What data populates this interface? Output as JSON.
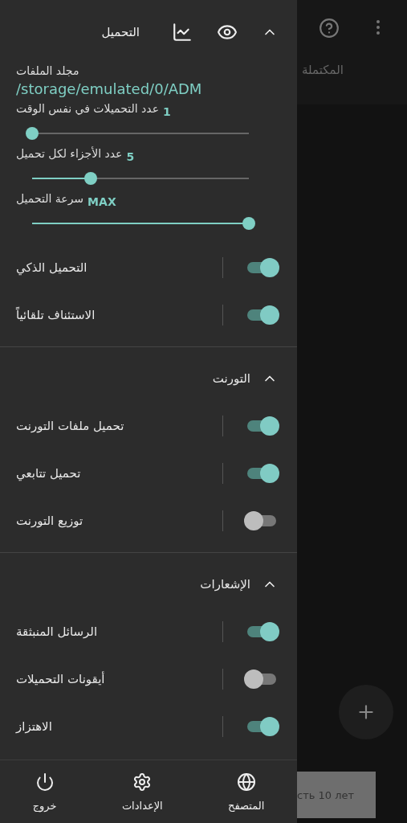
{
  "drawer": {
    "title": "التحميل",
    "expanded": true,
    "folder": {
      "label": "مجلد الملفات",
      "path": "/storage/emulated/0/ADM"
    },
    "sliders": [
      {
        "label": "عدد التحميلات في نفس الوقت",
        "value": "1",
        "level": 0
      },
      {
        "label": "عدد الأجزاء لكل تحميل",
        "value": "5",
        "level": 0.27
      },
      {
        "label": "سرعة التحميل",
        "value": "MAX",
        "level": 1
      }
    ],
    "toggles": [
      {
        "label": "التحميل الذكي",
        "on": true
      },
      {
        "label": "الاستئناف تلقائياً",
        "on": true
      }
    ],
    "sections": [
      {
        "title": "التورنت",
        "expanded": true,
        "toggles": [
          {
            "label": "تحميل ملفات التورنت",
            "on": true
          },
          {
            "label": "تحميل تتابعي",
            "on": true
          },
          {
            "label": "توزيع التورنت",
            "on": false
          }
        ]
      },
      {
        "title": "الإشعارات",
        "expanded": true,
        "toggles": [
          {
            "label": "الرسائل المنبثقة",
            "on": true
          },
          {
            "label": "أيقونات التحميلات",
            "on": false
          },
          {
            "label": "الاهتزاز",
            "on": true
          }
        ]
      }
    ],
    "bottom_nav": [
      {
        "kind": "browser",
        "label": "المتصفح"
      },
      {
        "kind": "settings",
        "label": "الإعدادات"
      },
      {
        "kind": "exit",
        "label": "خروج"
      }
    ]
  },
  "background": {
    "tab": "المكتملة",
    "snackbar": "сть 10 лет"
  }
}
